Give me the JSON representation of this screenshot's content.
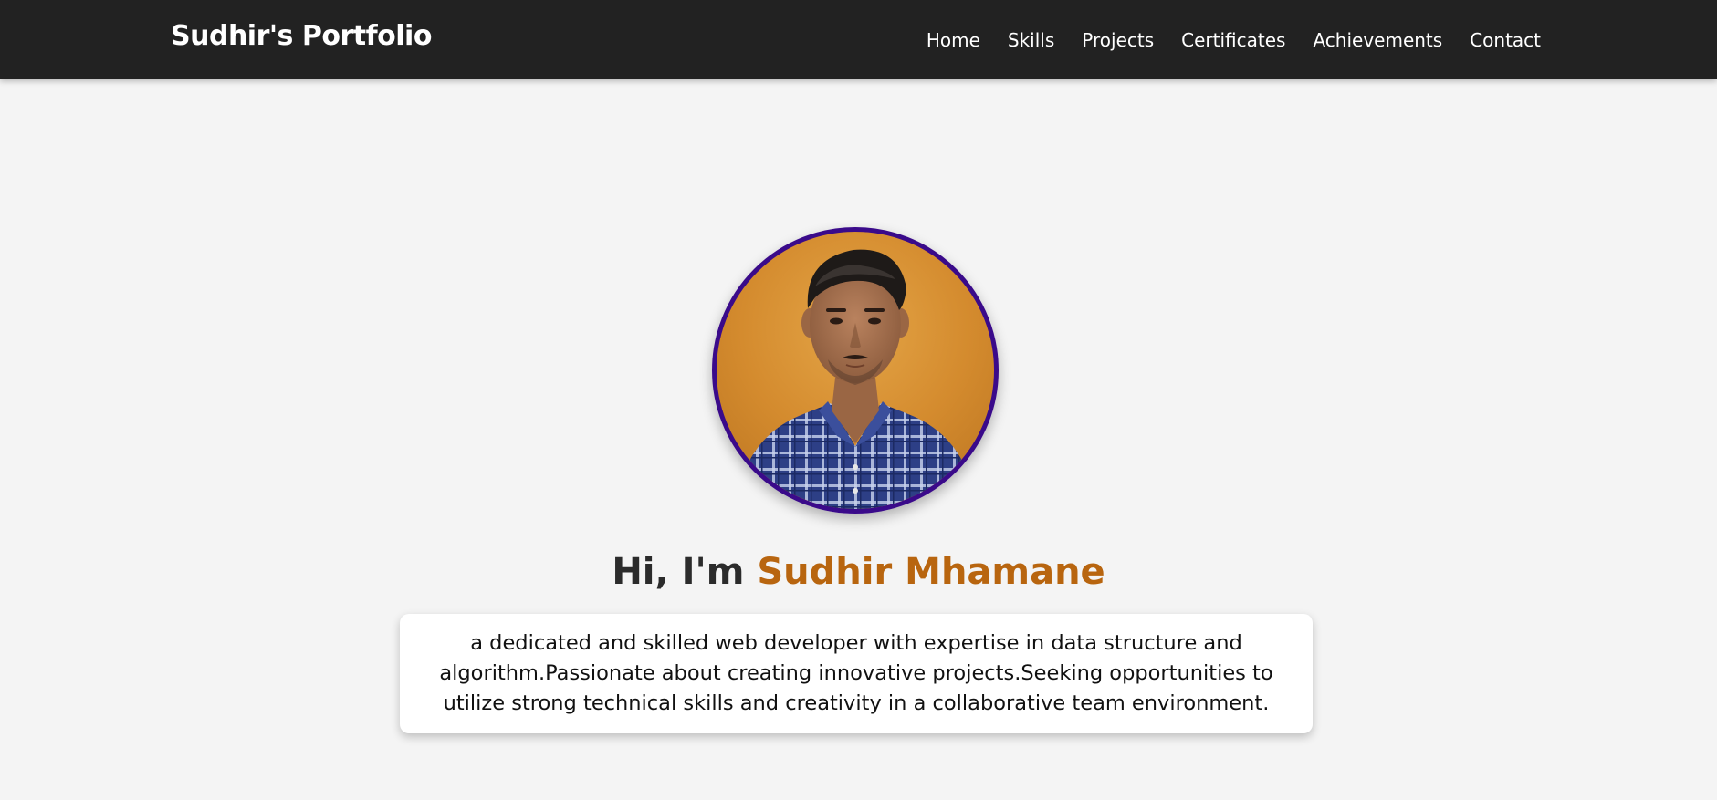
{
  "navbar": {
    "brand": "Sudhir's Portfolio",
    "links": [
      {
        "label": "Home"
      },
      {
        "label": "Skills"
      },
      {
        "label": "Projects"
      },
      {
        "label": "Certificates"
      },
      {
        "label": "Achievements"
      },
      {
        "label": "Contact"
      }
    ]
  },
  "hero": {
    "greeting_prefix": "Hi, I'm",
    "name": "Sudhir Mhamane",
    "bio": "a dedicated and skilled web developer with expertise in data structure and algorithm.Passionate about creating innovative projects.Seeking opportunities to utilize strong technical skills and creativity in a collaborative team environment."
  },
  "colors": {
    "navbar_bg": "#222222",
    "page_bg": "#f4f4f4",
    "accent_name": "#b8650f",
    "avatar_border": "#3a0a8a"
  }
}
